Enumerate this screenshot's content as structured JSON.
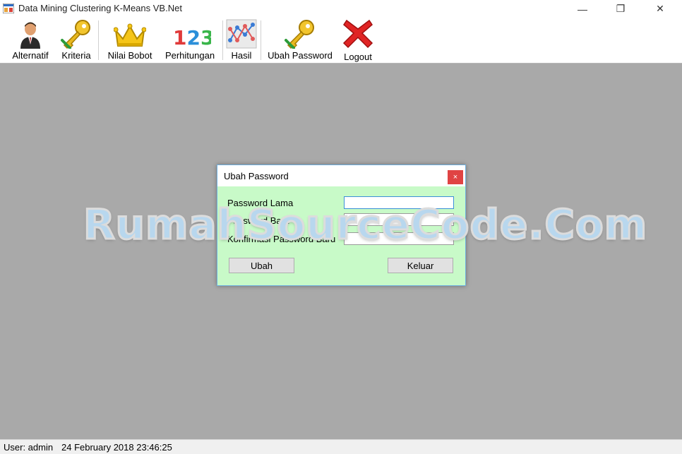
{
  "window": {
    "title": "Data Mining Clustering K-Means VB.Net",
    "minimize_glyph": "—",
    "restore_glyph": "❐",
    "close_glyph": "✕"
  },
  "toolbar": {
    "items": [
      {
        "label": "Alternatif",
        "icon": "person-icon"
      },
      {
        "label": "Kriteria",
        "icon": "key-icon"
      },
      {
        "label": "Nilai Bobot",
        "icon": "crown-icon"
      },
      {
        "label": "Perhitungan",
        "icon": "numbers-icon",
        "icon_text": "123"
      },
      {
        "label": "Hasil",
        "icon": "network-chart-icon"
      },
      {
        "label": "Ubah Password",
        "icon": "key-icon"
      },
      {
        "label": "Logout",
        "icon": "red-x-icon"
      }
    ]
  },
  "dialog": {
    "title": "Ubah Password",
    "close_glyph": "×",
    "fields": [
      {
        "label": "Password Lama",
        "value": ""
      },
      {
        "label": "Password Baru",
        "value": ""
      },
      {
        "label": "Konfirmasi Password Baru",
        "value": ""
      }
    ],
    "buttons": {
      "submit": "Ubah",
      "exit": "Keluar"
    }
  },
  "watermark": "RumahSourceCode.Com",
  "status": {
    "user": "User: admin",
    "datetime": "24 February 2018 23:46:25"
  },
  "colors": {
    "dialog_body": "#c8fac8",
    "mdi_background": "#a9a9a9",
    "close_button": "#e04343"
  }
}
